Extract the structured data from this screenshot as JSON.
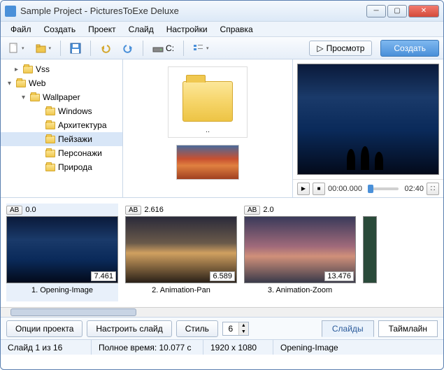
{
  "window": {
    "title": "Sample Project - PicturesToExe Deluxe"
  },
  "menu": {
    "file": "Файл",
    "create": "Создать",
    "project": "Проект",
    "slide": "Слайд",
    "settings": "Настройки",
    "help": "Справка"
  },
  "toolbar": {
    "drive": "C:",
    "preview": "Просмотр",
    "create": "Создать"
  },
  "tree": {
    "items": [
      {
        "label": "Vss",
        "indent": 20,
        "toggle": "▸"
      },
      {
        "label": "Web",
        "indent": 10,
        "toggle": "▾"
      },
      {
        "label": "Wallpaper",
        "indent": 30,
        "toggle": "▾"
      },
      {
        "label": "Windows",
        "indent": 52,
        "toggle": ""
      },
      {
        "label": "Архитектура",
        "indent": 52,
        "toggle": ""
      },
      {
        "label": "Пейзажи",
        "indent": 52,
        "toggle": "",
        "selected": true
      },
      {
        "label": "Персонажи",
        "indent": 52,
        "toggle": ""
      },
      {
        "label": "Природа",
        "indent": 52,
        "toggle": ""
      }
    ]
  },
  "filepane": {
    "parent": ".."
  },
  "preview": {
    "time_current": "00:00.000",
    "time_total": "02:40"
  },
  "slides": [
    {
      "start": "0.0",
      "duration": "7.461",
      "name": "1. Opening-Image",
      "bg": "linear-gradient(180deg,#0a1a3a 0%,#1a3a6a 35%,#0a2a5a 65%,#030a1a 100%)",
      "sel": true
    },
    {
      "start": "2.616",
      "duration": "6.589",
      "name": "2. Animation-Pan",
      "bg": "linear-gradient(180deg,#2a2a3a 0%,#6a5a4a 40%,#d0a060 55%,#2a2018 100%)"
    },
    {
      "start": "2.0",
      "duration": "13.476",
      "name": "3. Animation-Zoom",
      "bg": "linear-gradient(180deg,#3a3a5a 0%,#a06a7a 45%,#d0907a 60%,#3a3a4a 100%)"
    }
  ],
  "bottom": {
    "project_options": "Опции проекта",
    "configure_slide": "Настроить слайд",
    "style": "Стиль",
    "count": "6",
    "tab_slides": "Слайды",
    "tab_timeline": "Таймлайн"
  },
  "status": {
    "slide": "Слайд 1 из 16",
    "total_time": "Полное время: 10.077 с",
    "resolution": "1920 x 1080",
    "name": "Opening-Image"
  }
}
